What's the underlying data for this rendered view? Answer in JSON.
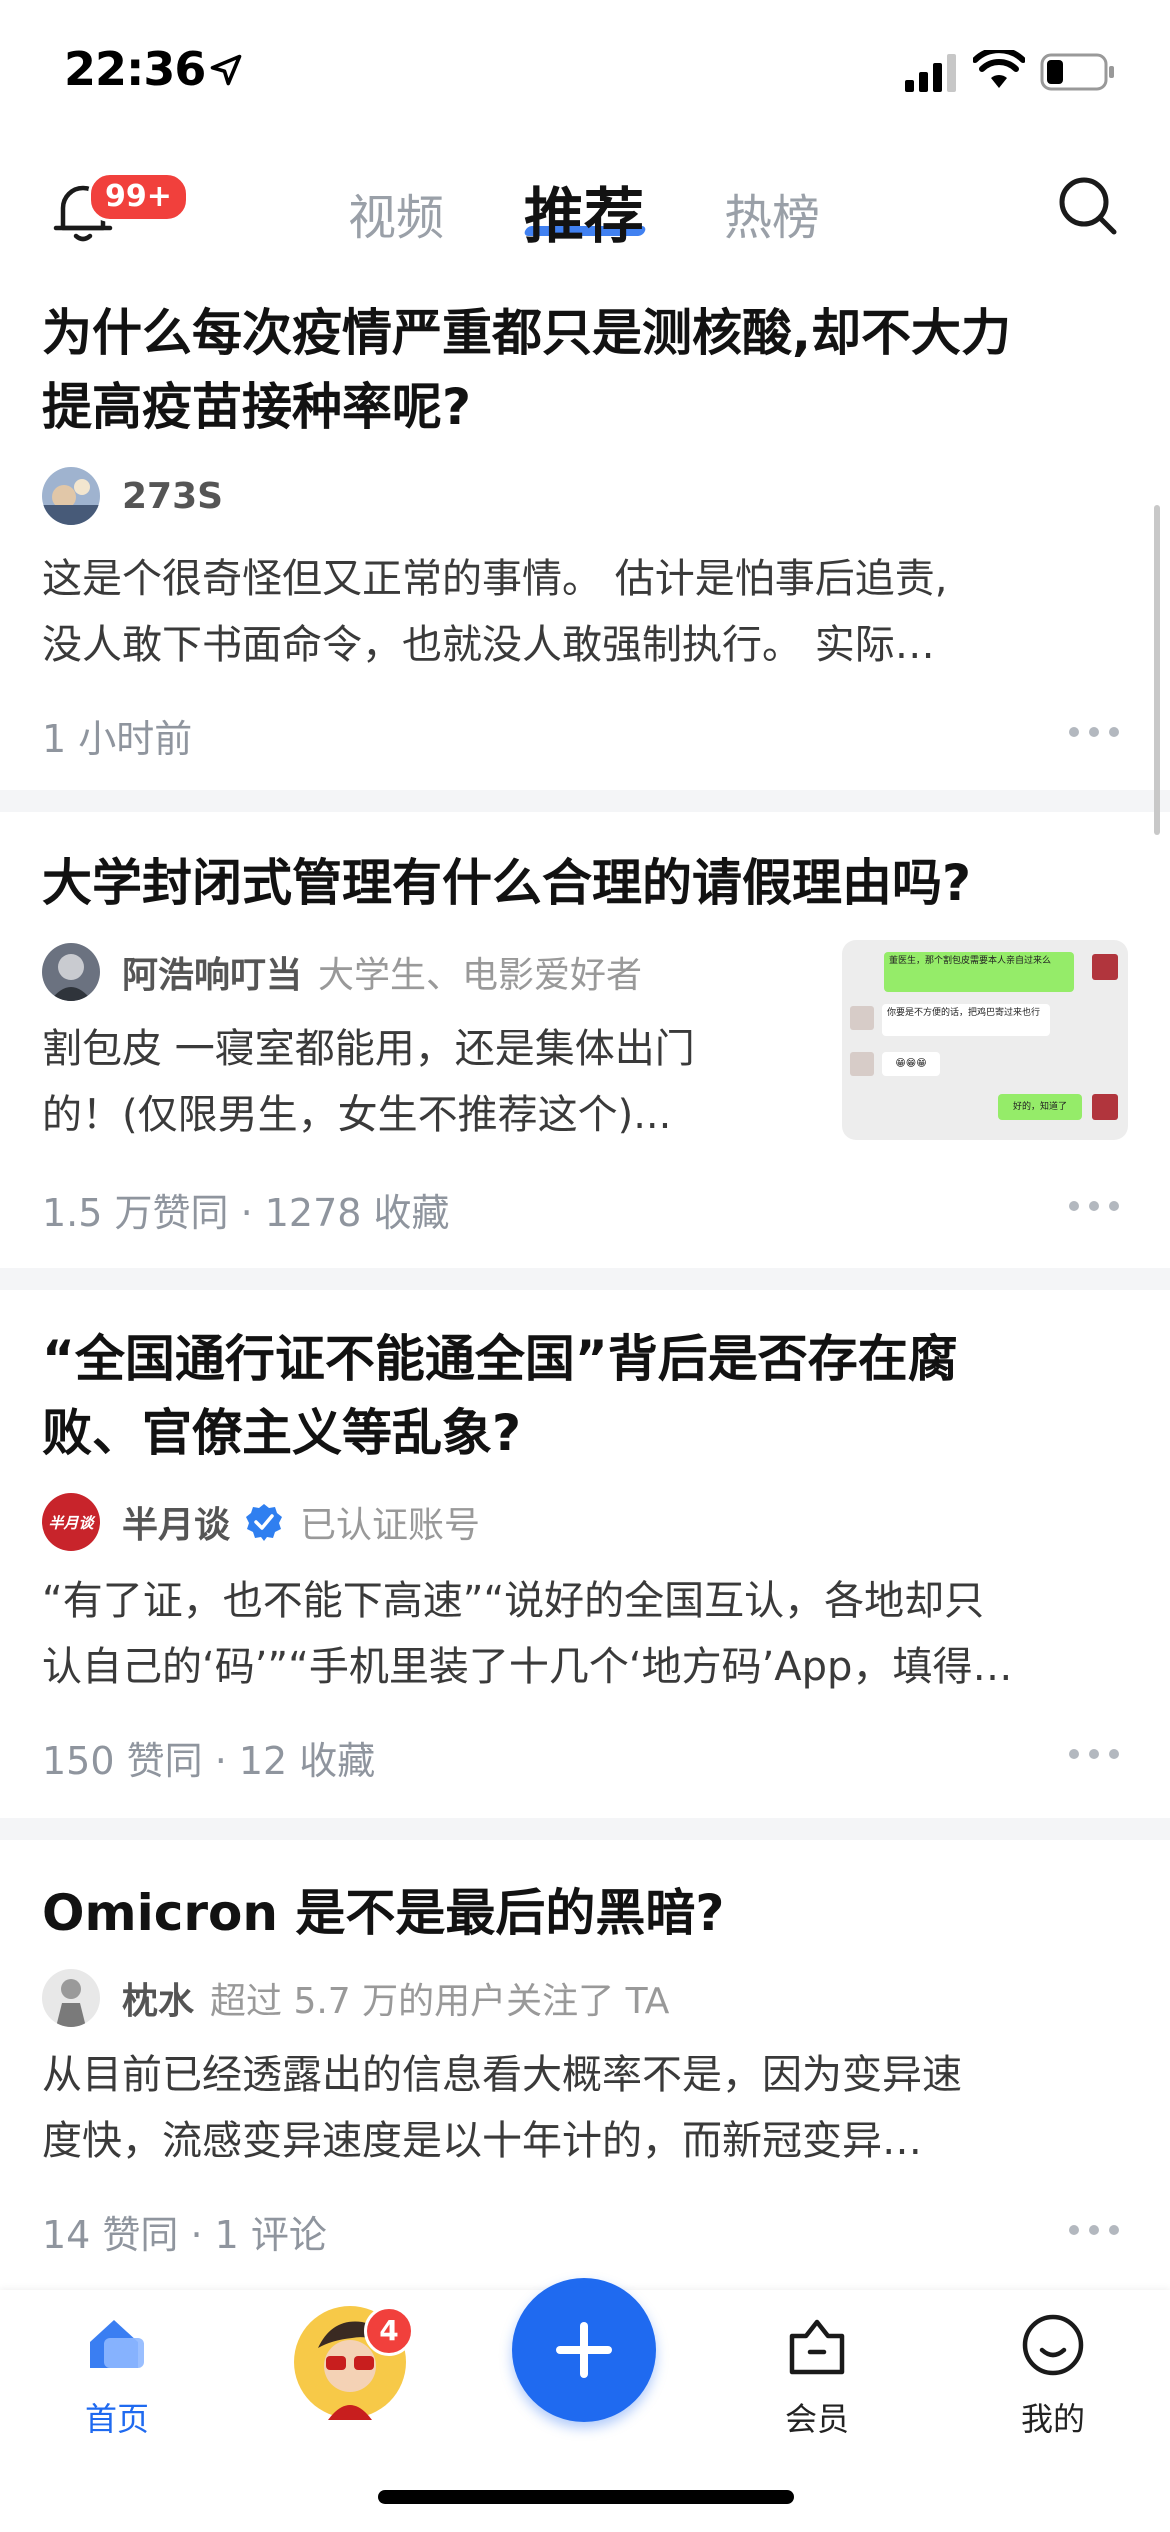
{
  "status_bar": {
    "time": "22:36"
  },
  "top_nav": {
    "notification_badge": "99+",
    "tabs": [
      {
        "label": "视频"
      },
      {
        "label": "推荐"
      },
      {
        "label": "热榜"
      }
    ]
  },
  "feed": [
    {
      "title": "为什么每次疫情严重都只是测核酸,却不大力提高疫苗接种率呢?",
      "title_line1": "为什么每次疫情严重都只是测核酸,却不大力",
      "title_line2": "提高疫苗接种率呢?",
      "author": "273S",
      "excerpt_line1": "这是个很奇怪但又正常的事情。 估计是怕事后追责,",
      "excerpt_line2": "没人敢下书面命令，也就没人敢强制执行。 实际…",
      "meta": "1 小时前"
    },
    {
      "title": "大学封闭式管理有什么合理的请假理由吗?",
      "author": "阿浩响叮当",
      "author_desc": "大学生、电影爱好者",
      "excerpt_line1": "割包皮 一寝室都能用，还是集体出门",
      "excerpt_line2": "的！(仅限男生，女生不推荐这个)...",
      "meta": "1.5 万赞同 · 1278 收藏",
      "thumbnail_texts": [
        "董医生，那个割包皮需要本人亲自过来么",
        "你要是不方便的话，把鸡巴寄过来也行",
        "😁😁😁",
        "好的，知道了"
      ]
    },
    {
      "title_line1": "“全国通行证不能通全国”背后是否存在腐",
      "title_line2": "败、官僚主义等乱象?",
      "author": "半月谈",
      "author_logo_text": "半月谈",
      "author_desc": "已认证账号",
      "excerpt_line1": "“有了证，也不能下高速”“说好的全国互认，各地却只",
      "excerpt_line2": "认自己的‘码’”“手机里装了十几个‘地方码’App，填得…",
      "meta": "150 赞同 · 12 收藏"
    },
    {
      "title": "Omicron 是不是最后的黑暗?",
      "author": "枕水",
      "author_desc": "超过 5.7 万的用户关注了 TA",
      "excerpt_line1": "从目前已经透露出的信息看大概率不是，因为变异速",
      "excerpt_line2": "度快，流感变异速度是以十年计的，而新冠变异…",
      "meta": "14 赞同 · 1 评论"
    }
  ],
  "bottom_nav": {
    "home_label": "首页",
    "avatar_badge": "4",
    "member_label": "会员",
    "me_label": "我的"
  },
  "colors": {
    "accent": "#1f6af0",
    "badge": "#f1403c"
  }
}
